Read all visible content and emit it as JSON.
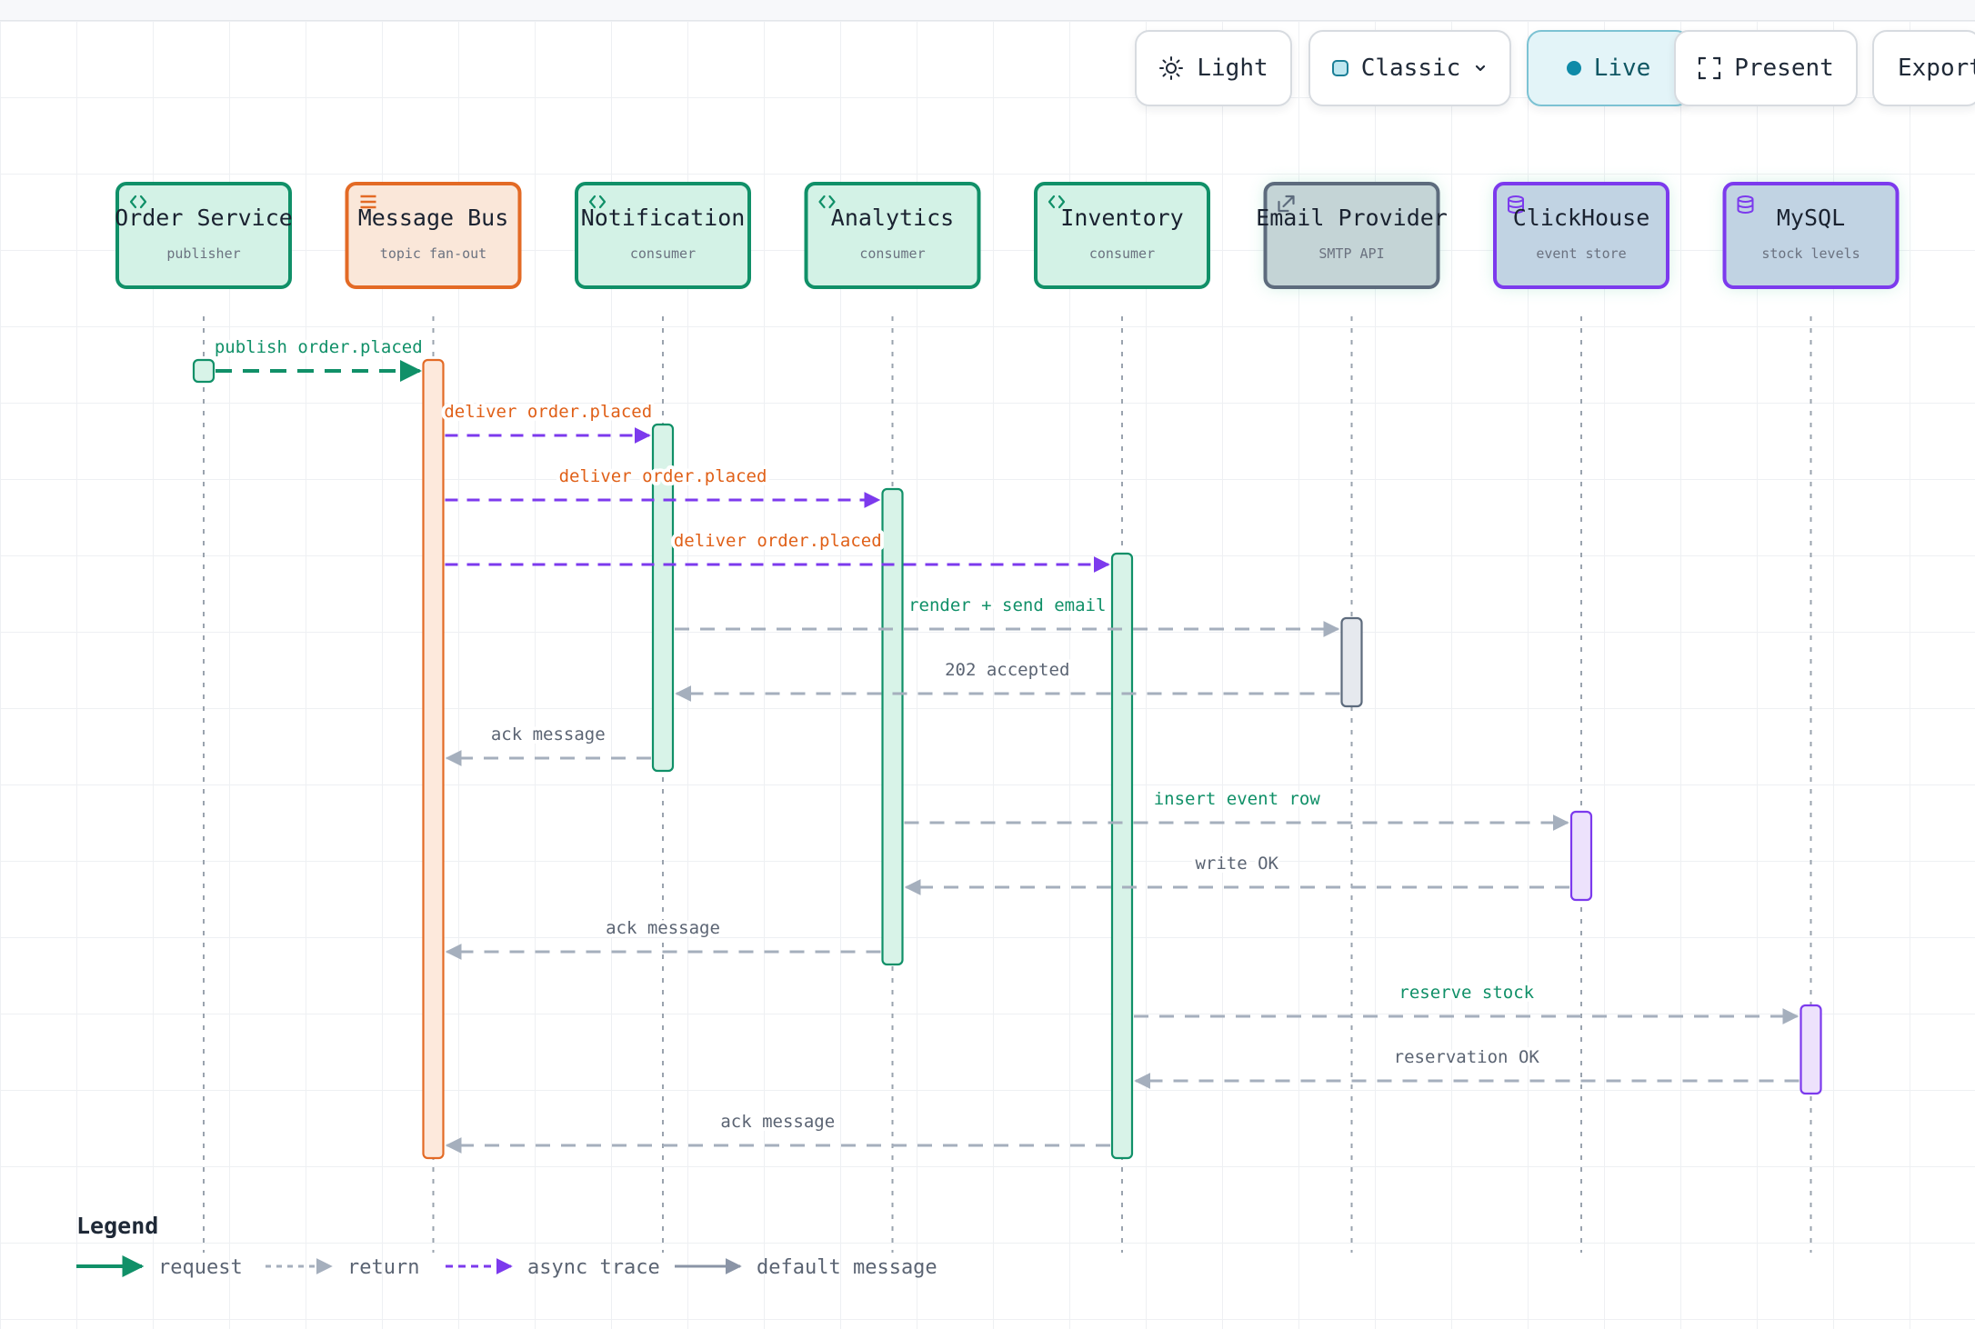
{
  "toolbar": {
    "theme_label": "Light",
    "style_label": "Classic",
    "live_label": "Live",
    "present_label": "Present",
    "export_label": "Export"
  },
  "participants": [
    {
      "id": "order",
      "name": "Order Service",
      "subtitle": "publisher",
      "kind": "service"
    },
    {
      "id": "bus",
      "name": "Message Bus",
      "subtitle": "topic fan-out",
      "kind": "queue"
    },
    {
      "id": "notif",
      "name": "Notification",
      "subtitle": "consumer",
      "kind": "service"
    },
    {
      "id": "analytics",
      "name": "Analytics",
      "subtitle": "consumer",
      "kind": "service"
    },
    {
      "id": "inventory",
      "name": "Inventory",
      "subtitle": "consumer",
      "kind": "service"
    },
    {
      "id": "email",
      "name": "Email Provider",
      "subtitle": "SMTP API",
      "kind": "external"
    },
    {
      "id": "clickhouse",
      "name": "ClickHouse",
      "subtitle": "event store",
      "kind": "database"
    },
    {
      "id": "mysql",
      "name": "MySQL",
      "subtitle": "stock levels",
      "kind": "database"
    }
  ],
  "messages": [
    {
      "from": 0,
      "to": 1,
      "label": "publish order.placed",
      "type": "request"
    },
    {
      "from": 1,
      "to": 2,
      "label": "deliver order.placed",
      "type": "async"
    },
    {
      "from": 1,
      "to": 3,
      "label": "deliver order.placed",
      "type": "async"
    },
    {
      "from": 1,
      "to": 4,
      "label": "deliver order.placed",
      "type": "async"
    },
    {
      "from": 2,
      "to": 5,
      "label": "render + send email",
      "type": "call"
    },
    {
      "from": 5,
      "to": 2,
      "label": "202 accepted",
      "type": "return"
    },
    {
      "from": 2,
      "to": 1,
      "label": "ack message",
      "type": "return"
    },
    {
      "from": 3,
      "to": 6,
      "label": "insert event row",
      "type": "call"
    },
    {
      "from": 6,
      "to": 3,
      "label": "write OK",
      "type": "return"
    },
    {
      "from": 3,
      "to": 1,
      "label": "ack message",
      "type": "return"
    },
    {
      "from": 4,
      "to": 7,
      "label": "reserve stock",
      "type": "call"
    },
    {
      "from": 7,
      "to": 4,
      "label": "reservation OK",
      "type": "return"
    },
    {
      "from": 4,
      "to": 1,
      "label": "ack message",
      "type": "return"
    }
  ],
  "activations": [
    {
      "participant": 0,
      "from_msg": 0,
      "to_msg": 0
    },
    {
      "participant": 1,
      "from_msg": 0,
      "to_msg": 12
    },
    {
      "participant": 2,
      "from_msg": 1,
      "to_msg": 6
    },
    {
      "participant": 3,
      "from_msg": 2,
      "to_msg": 9
    },
    {
      "participant": 4,
      "from_msg": 3,
      "to_msg": 12
    },
    {
      "participant": 5,
      "from_msg": 4,
      "to_msg": 5
    },
    {
      "participant": 6,
      "from_msg": 7,
      "to_msg": 8
    },
    {
      "participant": 7,
      "from_msg": 10,
      "to_msg": 11
    }
  ],
  "legend": {
    "title": "Legend",
    "items": [
      {
        "label": "request",
        "type": "request"
      },
      {
        "label": "return",
        "type": "return"
      },
      {
        "label": "async trace",
        "type": "async"
      },
      {
        "label": "default message",
        "type": "default"
      }
    ]
  },
  "colors": {
    "service_fill": "#d3f2e6",
    "service_stroke": "#109068",
    "queue_fill": "#fae7d9",
    "queue_stroke": "#e36a25",
    "external_fill": "#c4d4d6",
    "external_stroke": "#5d6b7d",
    "database_fill": "#c1d3e3",
    "database_stroke": "#7c3aed",
    "request": "#109068",
    "async": "#7c3aed",
    "return": "#a5afbd",
    "default": "#8a94a6",
    "label_request": "#109068",
    "label_async": "#e06018",
    "label_return": "#5b6473"
  }
}
